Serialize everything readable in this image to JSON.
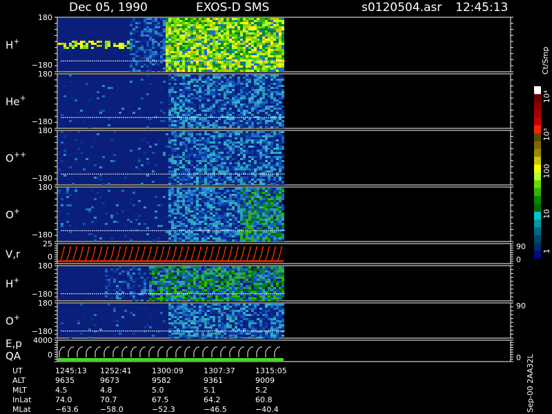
{
  "header": {
    "date": "Dec 05, 1990",
    "instrument": "EXOS-D SMS",
    "file": "s0120504.asr",
    "time": "12:45:13"
  },
  "panels": [
    {
      "id": "h-plus-1",
      "label": "H",
      "sup": "+",
      "ymax": "180",
      "ymin": "−180",
      "data_end": 0.33
    },
    {
      "id": "he-plus",
      "label": "He",
      "sup": "+",
      "ymax": "180",
      "ymin": "−180",
      "data_end": 0.33
    },
    {
      "id": "o-plusplus",
      "label": "O",
      "sup": "++",
      "ymax": "180",
      "ymin": "−180",
      "data_end": 0.33
    },
    {
      "id": "o-plus-1",
      "label": "O",
      "sup": "+",
      "ymax": "180",
      "ymin": "−180",
      "data_end": 0.33
    },
    {
      "id": "vr",
      "label": "V,r",
      "sup": "",
      "ymax": "25",
      "ymin": "0",
      "right_top": "90",
      "right_bottom": "0"
    },
    {
      "id": "h-plus-2",
      "label": "H",
      "sup": "+",
      "ymax": "180",
      "ymin": "−180"
    },
    {
      "id": "o-plus-2",
      "label": "O",
      "sup": "+",
      "ymax": "180",
      "ymin": "−180",
      "right_top": "90"
    },
    {
      "id": "ep-qa",
      "label": "E,p",
      "label2": "QA",
      "sup": "",
      "ymax": "4000",
      "ymin": "0",
      "right_bottom": "0"
    }
  ],
  "colorbar": {
    "title": "Ct/Smp",
    "labels": [
      "10⁴",
      "10³",
      "100",
      "10",
      "1"
    ],
    "colors": [
      "#ffffff",
      "#6b0000",
      "#8b0000",
      "#a50000",
      "#c80000",
      "#ff2200",
      "#5a4a00",
      "#7a6a00",
      "#9a8a00",
      "#c8c800",
      "#ffff00",
      "#b4ff32",
      "#64dc00",
      "#32b400",
      "#008c00",
      "#006a00",
      "#00c8c8",
      "#009aa0",
      "#00648c",
      "#00466e",
      "#002a6e",
      "#000a78"
    ]
  },
  "footer": {
    "rows": [
      {
        "label": "UT",
        "values": [
          "1245:13",
          "1252:41",
          "1300:09",
          "1307:37",
          "1315:05"
        ]
      },
      {
        "label": "ALT",
        "values": [
          "9635",
          "9673",
          "9582",
          "9361",
          "9009"
        ]
      },
      {
        "label": "MLT",
        "values": [
          "4.5",
          "4.8",
          "5.0",
          "5.1",
          "5.2"
        ]
      },
      {
        "label": "InLat",
        "values": [
          "74.0",
          "70.7",
          "67.5",
          "64.2",
          "60.8"
        ]
      },
      {
        "label": "MLat",
        "values": [
          "−63.6",
          "−58.0",
          "−52.3",
          "−46.5",
          "−40.4"
        ]
      }
    ],
    "side_note": "Sep-00  2AA32L"
  },
  "chart_data": {
    "type": "heatmap",
    "title": "Dec 05, 1990   EXOS-D SMS",
    "xlabel": "UT",
    "x_ticks": [
      "1245:13",
      "1252:41",
      "1300:09",
      "1307:37",
      "1315:05"
    ],
    "series": [
      {
        "name": "H+",
        "ylim": [
          -180,
          180
        ]
      },
      {
        "name": "He+",
        "ylim": [
          -180,
          180
        ]
      },
      {
        "name": "O++",
        "ylim": [
          -180,
          180
        ]
      },
      {
        "name": "O+",
        "ylim": [
          -180,
          180
        ]
      },
      {
        "name": "V,r",
        "ylim": [
          0,
          25
        ]
      },
      {
        "name": "H+",
        "ylim": [
          -180,
          180
        ]
      },
      {
        "name": "O+",
        "ylim": [
          -180,
          180
        ]
      },
      {
        "name": "E,p",
        "ylim": [
          0,
          4000
        ]
      }
    ],
    "colorbar_scale": "log",
    "colorbar_range": [
      1,
      10000
    ]
  }
}
